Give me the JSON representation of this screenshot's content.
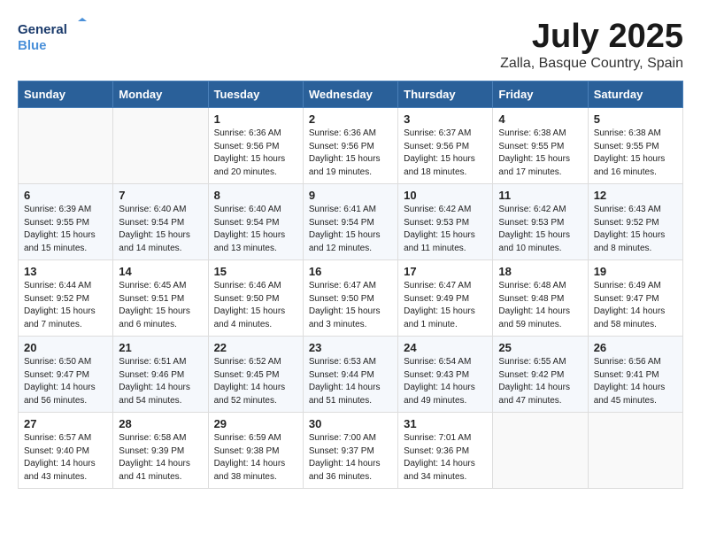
{
  "header": {
    "logo_line1": "General",
    "logo_line2": "Blue",
    "month": "July 2025",
    "location": "Zalla, Basque Country, Spain"
  },
  "weekdays": [
    "Sunday",
    "Monday",
    "Tuesday",
    "Wednesday",
    "Thursday",
    "Friday",
    "Saturday"
  ],
  "weeks": [
    [
      {
        "day": "",
        "detail": ""
      },
      {
        "day": "",
        "detail": ""
      },
      {
        "day": "1",
        "detail": "Sunrise: 6:36 AM\nSunset: 9:56 PM\nDaylight: 15 hours\nand 20 minutes."
      },
      {
        "day": "2",
        "detail": "Sunrise: 6:36 AM\nSunset: 9:56 PM\nDaylight: 15 hours\nand 19 minutes."
      },
      {
        "day": "3",
        "detail": "Sunrise: 6:37 AM\nSunset: 9:56 PM\nDaylight: 15 hours\nand 18 minutes."
      },
      {
        "day": "4",
        "detail": "Sunrise: 6:38 AM\nSunset: 9:55 PM\nDaylight: 15 hours\nand 17 minutes."
      },
      {
        "day": "5",
        "detail": "Sunrise: 6:38 AM\nSunset: 9:55 PM\nDaylight: 15 hours\nand 16 minutes."
      }
    ],
    [
      {
        "day": "6",
        "detail": "Sunrise: 6:39 AM\nSunset: 9:55 PM\nDaylight: 15 hours\nand 15 minutes."
      },
      {
        "day": "7",
        "detail": "Sunrise: 6:40 AM\nSunset: 9:54 PM\nDaylight: 15 hours\nand 14 minutes."
      },
      {
        "day": "8",
        "detail": "Sunrise: 6:40 AM\nSunset: 9:54 PM\nDaylight: 15 hours\nand 13 minutes."
      },
      {
        "day": "9",
        "detail": "Sunrise: 6:41 AM\nSunset: 9:54 PM\nDaylight: 15 hours\nand 12 minutes."
      },
      {
        "day": "10",
        "detail": "Sunrise: 6:42 AM\nSunset: 9:53 PM\nDaylight: 15 hours\nand 11 minutes."
      },
      {
        "day": "11",
        "detail": "Sunrise: 6:42 AM\nSunset: 9:53 PM\nDaylight: 15 hours\nand 10 minutes."
      },
      {
        "day": "12",
        "detail": "Sunrise: 6:43 AM\nSunset: 9:52 PM\nDaylight: 15 hours\nand 8 minutes."
      }
    ],
    [
      {
        "day": "13",
        "detail": "Sunrise: 6:44 AM\nSunset: 9:52 PM\nDaylight: 15 hours\nand 7 minutes."
      },
      {
        "day": "14",
        "detail": "Sunrise: 6:45 AM\nSunset: 9:51 PM\nDaylight: 15 hours\nand 6 minutes."
      },
      {
        "day": "15",
        "detail": "Sunrise: 6:46 AM\nSunset: 9:50 PM\nDaylight: 15 hours\nand 4 minutes."
      },
      {
        "day": "16",
        "detail": "Sunrise: 6:47 AM\nSunset: 9:50 PM\nDaylight: 15 hours\nand 3 minutes."
      },
      {
        "day": "17",
        "detail": "Sunrise: 6:47 AM\nSunset: 9:49 PM\nDaylight: 15 hours\nand 1 minute."
      },
      {
        "day": "18",
        "detail": "Sunrise: 6:48 AM\nSunset: 9:48 PM\nDaylight: 14 hours\nand 59 minutes."
      },
      {
        "day": "19",
        "detail": "Sunrise: 6:49 AM\nSunset: 9:47 PM\nDaylight: 14 hours\nand 58 minutes."
      }
    ],
    [
      {
        "day": "20",
        "detail": "Sunrise: 6:50 AM\nSunset: 9:47 PM\nDaylight: 14 hours\nand 56 minutes."
      },
      {
        "day": "21",
        "detail": "Sunrise: 6:51 AM\nSunset: 9:46 PM\nDaylight: 14 hours\nand 54 minutes."
      },
      {
        "day": "22",
        "detail": "Sunrise: 6:52 AM\nSunset: 9:45 PM\nDaylight: 14 hours\nand 52 minutes."
      },
      {
        "day": "23",
        "detail": "Sunrise: 6:53 AM\nSunset: 9:44 PM\nDaylight: 14 hours\nand 51 minutes."
      },
      {
        "day": "24",
        "detail": "Sunrise: 6:54 AM\nSunset: 9:43 PM\nDaylight: 14 hours\nand 49 minutes."
      },
      {
        "day": "25",
        "detail": "Sunrise: 6:55 AM\nSunset: 9:42 PM\nDaylight: 14 hours\nand 47 minutes."
      },
      {
        "day": "26",
        "detail": "Sunrise: 6:56 AM\nSunset: 9:41 PM\nDaylight: 14 hours\nand 45 minutes."
      }
    ],
    [
      {
        "day": "27",
        "detail": "Sunrise: 6:57 AM\nSunset: 9:40 PM\nDaylight: 14 hours\nand 43 minutes."
      },
      {
        "day": "28",
        "detail": "Sunrise: 6:58 AM\nSunset: 9:39 PM\nDaylight: 14 hours\nand 41 minutes."
      },
      {
        "day": "29",
        "detail": "Sunrise: 6:59 AM\nSunset: 9:38 PM\nDaylight: 14 hours\nand 38 minutes."
      },
      {
        "day": "30",
        "detail": "Sunrise: 7:00 AM\nSunset: 9:37 PM\nDaylight: 14 hours\nand 36 minutes."
      },
      {
        "day": "31",
        "detail": "Sunrise: 7:01 AM\nSunset: 9:36 PM\nDaylight: 14 hours\nand 34 minutes."
      },
      {
        "day": "",
        "detail": ""
      },
      {
        "day": "",
        "detail": ""
      }
    ]
  ]
}
